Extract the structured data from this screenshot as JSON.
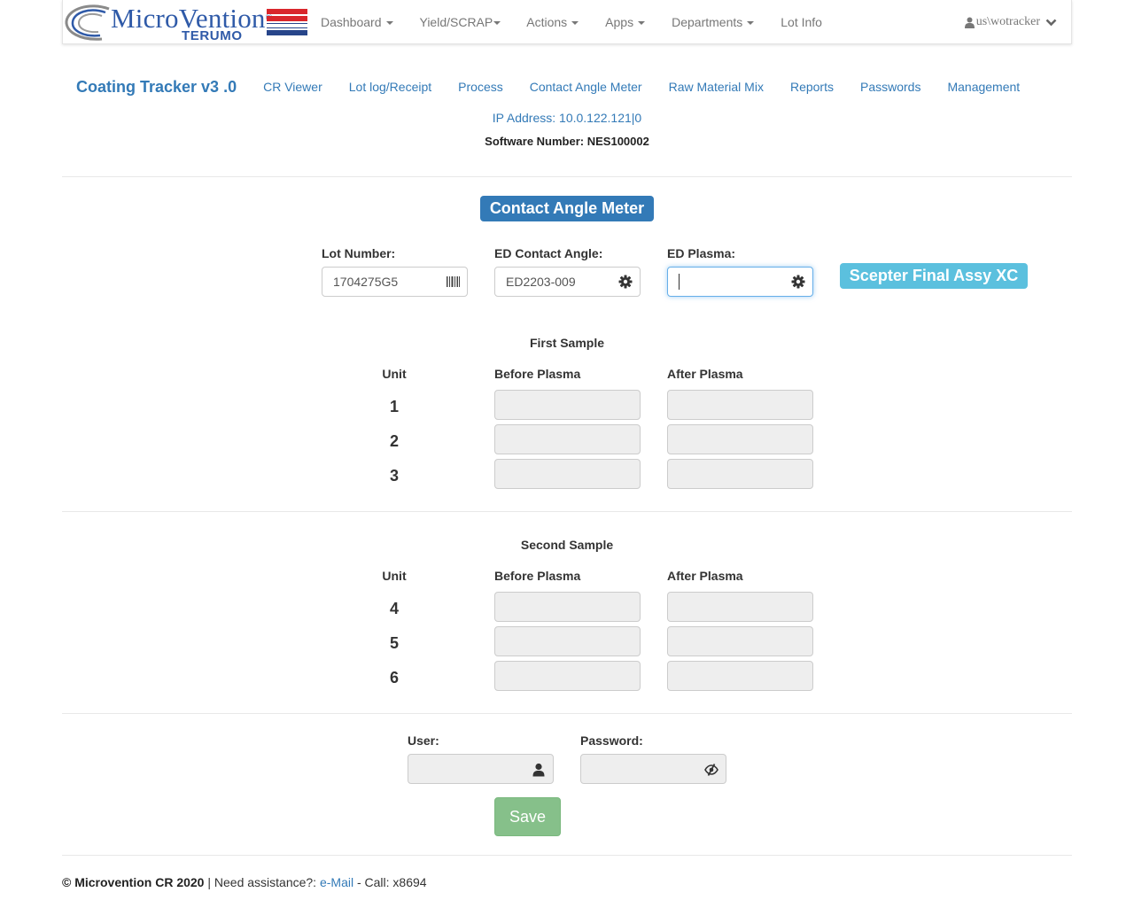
{
  "navbar": {
    "logo": {
      "brand": "MicroVention",
      "reg_mark": "®",
      "sub": "TERUMO"
    },
    "menu": [
      {
        "label": "Dashboard",
        "dropdown": true
      },
      {
        "label": "Yield/SCRAP",
        "dropdown": true
      },
      {
        "label": "Actions",
        "dropdown": true
      },
      {
        "label": "Apps",
        "dropdown": true
      },
      {
        "label": "Departments",
        "dropdown": true
      },
      {
        "label": "Lot Info",
        "dropdown": false
      }
    ],
    "user": "us\\wotracker"
  },
  "subnav": {
    "title": "Coating Tracker v3 .0",
    "links": [
      "CR Viewer",
      "Lot log/Receipt",
      "Process",
      "Contact Angle Meter",
      "Raw Material Mix",
      "Reports",
      "Passwords",
      "Management"
    ]
  },
  "ip_address": "IP Address: 10.0.122.121|0",
  "software_number": "Software Number: NES100002",
  "form": {
    "heading": "Contact Angle Meter",
    "lot_number": {
      "label": "Lot Number:",
      "value": "1704275G5",
      "icon": "barcode-icon"
    },
    "ed_contact_angle": {
      "label": "ED Contact Angle:",
      "value": "ED2203-009",
      "icon": "gear-icon"
    },
    "ed_plasma": {
      "label": "ED Plasma:",
      "value": "",
      "icon": "gear-icon"
    },
    "product_badge": "Scepter Final Assy XC",
    "first_sample": {
      "title": "First Sample",
      "col_unit": "Unit",
      "col_before": "Before Plasma",
      "col_after": "After Plasma",
      "units": [
        "1",
        "2",
        "3"
      ]
    },
    "second_sample": {
      "title": "Second Sample",
      "col_unit": "Unit",
      "col_before": "Before Plasma",
      "col_after": "After Plasma",
      "units": [
        "4",
        "5",
        "6"
      ]
    },
    "login": {
      "user_label": "User:",
      "user_icon": "user-icon",
      "password_label": "Password:",
      "password_icon": "eye-slash-icon"
    },
    "save_label": "Save"
  },
  "footer": {
    "copyright": "© Microvention CR 2020",
    "sep": " | Need assistance?: ",
    "email": "e-Mail",
    "call": " - Call: x8694"
  },
  "colors": {
    "primary": "#337ab7",
    "info": "#5bc0de",
    "success_disabled": "#86c08a",
    "flag_red": "#d9262c",
    "flag_blue": "#27458a"
  }
}
